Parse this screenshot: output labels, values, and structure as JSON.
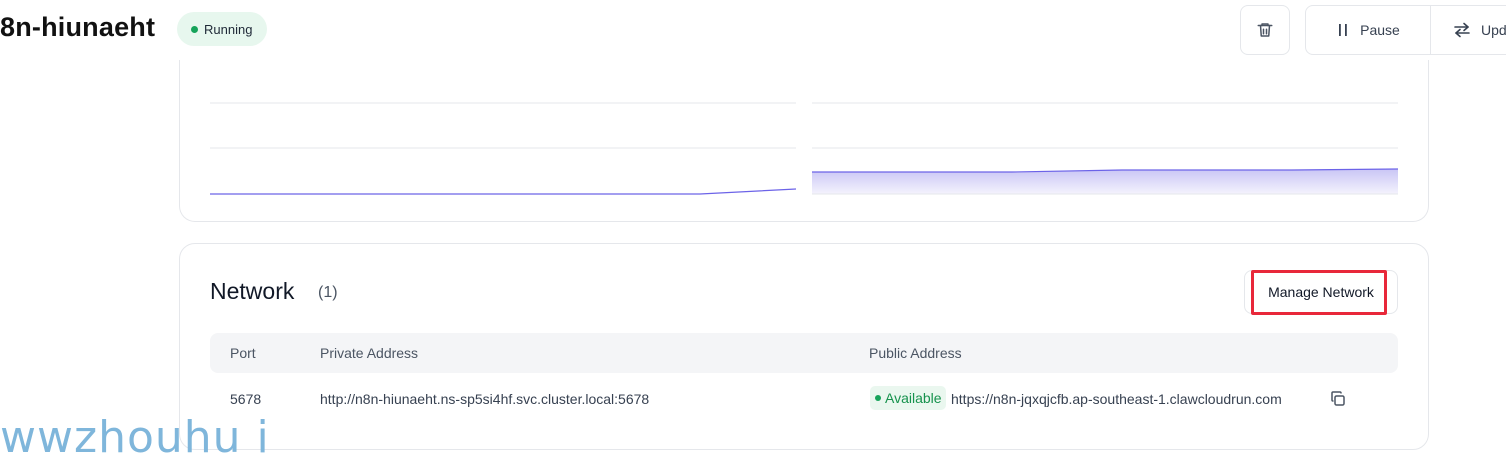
{
  "header": {
    "app_name": "8n-hiunaeht",
    "status": "Running",
    "pause_label": "Pause",
    "update_label": "Upd"
  },
  "network": {
    "title": "Network",
    "count": "(1)",
    "manage_label": "Manage Network",
    "columns": [
      "Port",
      "Private Address",
      "Public Address"
    ],
    "rows": [
      {
        "port": "5678",
        "private_address": "http://n8n-hiunaeht.ns-sp5si4hf.svc.cluster.local:5678",
        "status": "Available",
        "public_address": "https://n8n-jqxqjcfb.ap-southeast-1.clawcloudrun.com"
      }
    ]
  },
  "watermark": "wwzhouhu i",
  "colors": {
    "running_green": "#16a35a",
    "chart_line": "#6c63e8",
    "highlight_red": "#e8283a"
  }
}
